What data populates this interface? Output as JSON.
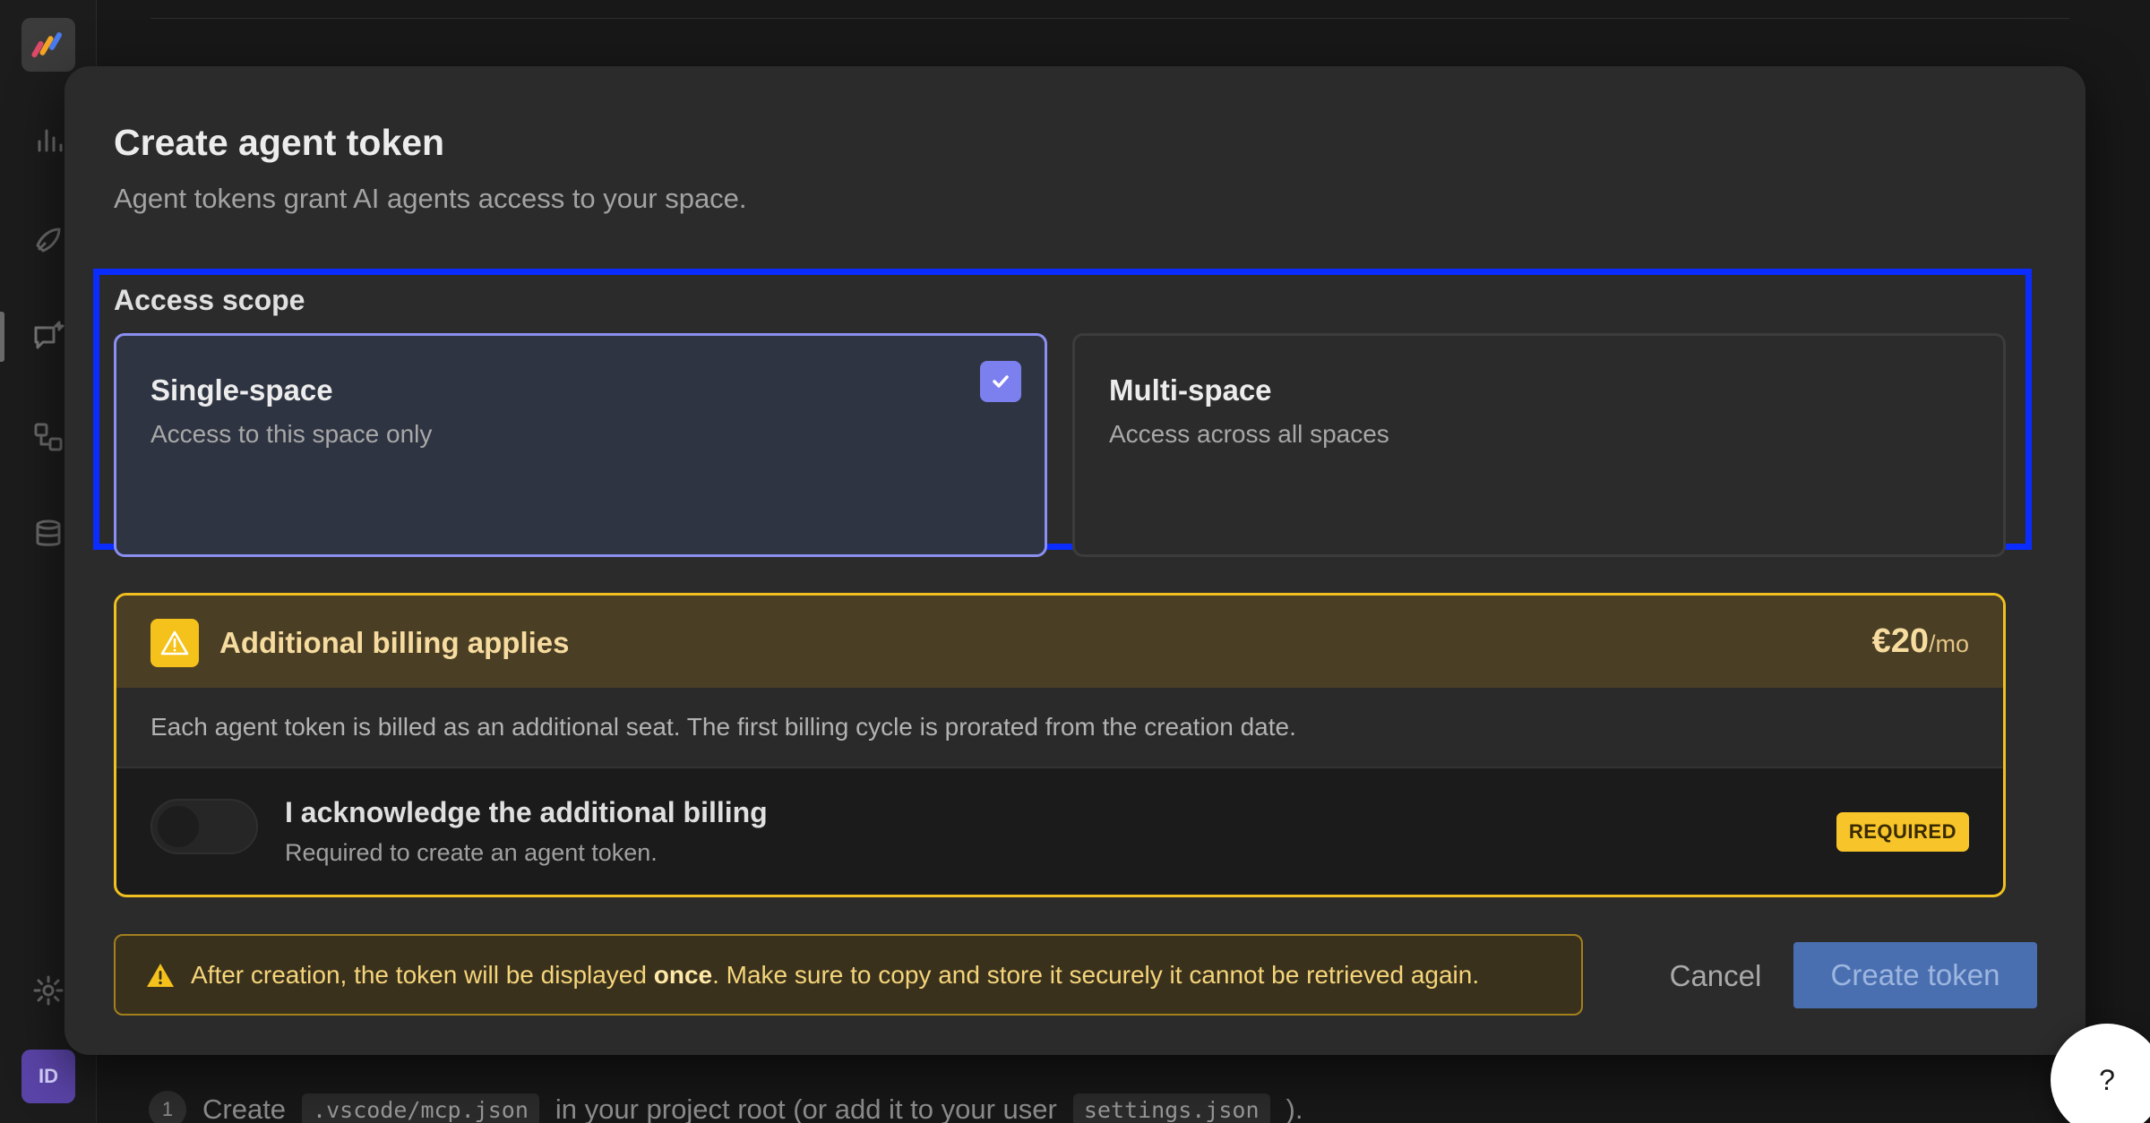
{
  "rail": {
    "avatar_initials": "ID"
  },
  "background": {
    "step_number": "1",
    "step_prefix": "Create",
    "step_code_1": ".vscode/mcp.json",
    "step_middle": "in your project root (or add it to your user",
    "step_code_2": "settings.json",
    "step_suffix": ")."
  },
  "modal": {
    "title": "Create agent token",
    "subtitle": "Agent tokens grant AI agents access to your space.",
    "scope": {
      "label": "Access scope",
      "options": [
        {
          "name": "Single-space",
          "description": "Access to this space only",
          "selected": true
        },
        {
          "name": "Multi-space",
          "description": "Access across all spaces",
          "selected": false
        }
      ]
    },
    "billing": {
      "title": "Additional billing applies",
      "price": "€20",
      "period": "/mo",
      "description": "Each agent token is billed as an additional seat. The first billing cycle is prorated from the creation date.",
      "ack_title": "I acknowledge the additional billing",
      "ack_subtitle": "Required to create an agent token.",
      "required_badge": "REQUIRED",
      "acknowledged": false
    },
    "footer": {
      "warning_before": "After creation, the token will be displayed ",
      "warning_bold": "once",
      "warning_after": ". Make sure to copy and store it securely it cannot be retrieved again.",
      "cancel_label": "Cancel",
      "create_label": "Create token"
    }
  },
  "help": {
    "label": "?"
  },
  "colors": {
    "accent": "#7c80ef",
    "highlight_border": "#0a2cff",
    "warning": "#f5c21b",
    "primary_button": "#4a6fb0"
  }
}
